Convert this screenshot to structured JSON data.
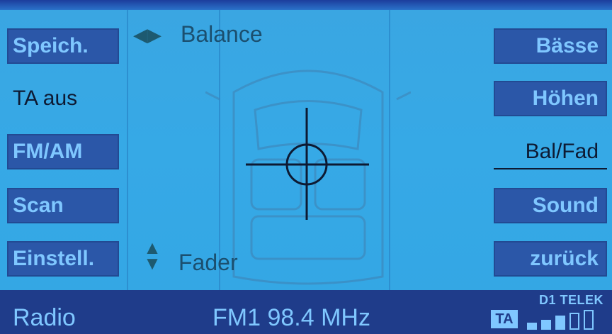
{
  "left_softkeys": [
    {
      "label": "Speich."
    },
    {
      "label": "TA aus"
    },
    {
      "label": "FM/AM"
    },
    {
      "label": "Scan"
    },
    {
      "label": "Einstell."
    }
  ],
  "right_softkeys": [
    {
      "label": "Bässe"
    },
    {
      "label": "Höhen"
    },
    {
      "label": "Bal/Fad"
    },
    {
      "label": "Sound"
    },
    {
      "label": "zurück"
    }
  ],
  "balance": {
    "label": "Balance"
  },
  "fader": {
    "label": "Fader"
  },
  "status": {
    "source": "Radio",
    "station": "FM1 98.4 MHz",
    "network": "D1 TELEK",
    "ta_badge": "TA"
  },
  "signal_strength": {
    "filled_bars": 3,
    "total_bars": 5
  },
  "colors": {
    "screen_background": "#36a9e6",
    "softkey_background": "#2b57a8",
    "softkey_text": "#7fc7ff",
    "statusbar_background": "#1f3c8a"
  }
}
